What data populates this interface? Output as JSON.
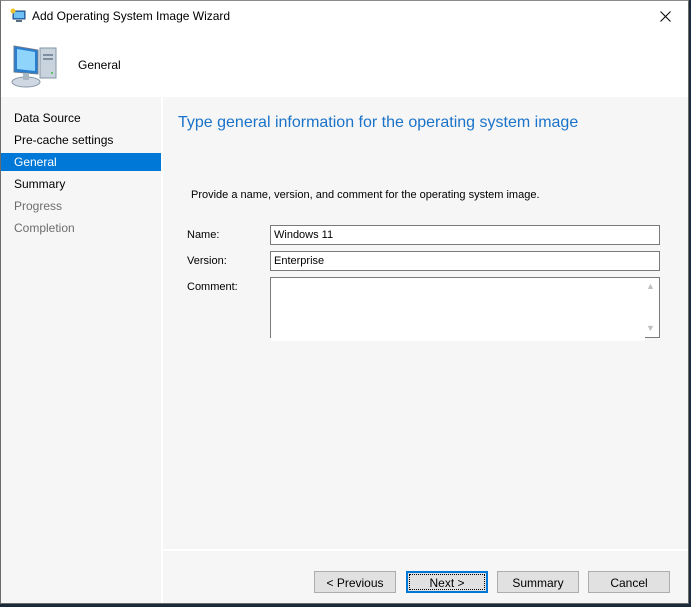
{
  "window": {
    "title": "Add Operating System Image Wizard",
    "icon": "wizard-computer-icon",
    "close_icon": "close-icon"
  },
  "header": {
    "title": "General",
    "icon": "computer-icon"
  },
  "nav": {
    "items": [
      {
        "label": "Data Source",
        "state": "normal"
      },
      {
        "label": "Pre-cache settings",
        "state": "normal"
      },
      {
        "label": "General",
        "state": "active"
      },
      {
        "label": "Summary",
        "state": "normal"
      },
      {
        "label": "Progress",
        "state": "disabled"
      },
      {
        "label": "Completion",
        "state": "disabled"
      }
    ]
  },
  "content": {
    "heading": "Type general information for the operating system image",
    "instructions": "Provide a name, version, and comment for the operating system image.",
    "fields": {
      "name": {
        "label": "Name:",
        "value": "Windows 11"
      },
      "version": {
        "label": "Version:",
        "value": "Enterprise"
      },
      "comment": {
        "label": "Comment:",
        "value": ""
      }
    }
  },
  "buttons": {
    "previous": "< Previous",
    "next": "Next >",
    "summary": "Summary",
    "cancel": "Cancel"
  },
  "colors": {
    "accent": "#0078d7",
    "heading": "#1a73c9",
    "panel_bg": "#f6f6f6"
  }
}
